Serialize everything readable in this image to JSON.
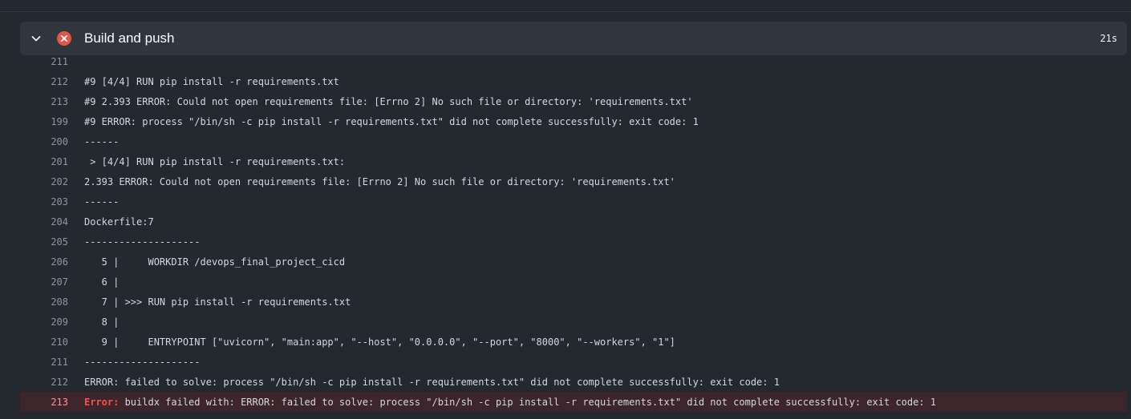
{
  "step": {
    "title": "Build and push",
    "duration": "21s",
    "status": "failed",
    "status_icon": "x-circle-icon",
    "chevron_icon": "chevron-down-icon",
    "colors": {
      "error": "#f85149",
      "header_bg": "#30363e",
      "log_bg": "#24292f",
      "error_row_bg": "#3d262b"
    }
  },
  "log": {
    "lines": [
      {
        "num": "211",
        "text": ""
      },
      {
        "num": "212",
        "text": "#9 [4/4] RUN pip install -r requirements.txt"
      },
      {
        "num": "213",
        "text": "#9 2.393 ERROR: Could not open requirements file: [Errno 2] No such file or directory: 'requirements.txt'"
      },
      {
        "num": "199",
        "text": "#9 ERROR: process \"/bin/sh -c pip install -r requirements.txt\" did not complete successfully: exit code: 1"
      },
      {
        "num": "200",
        "text": "------"
      },
      {
        "num": "201",
        "text": " > [4/4] RUN pip install -r requirements.txt:"
      },
      {
        "num": "202",
        "text": "2.393 ERROR: Could not open requirements file: [Errno 2] No such file or directory: 'requirements.txt'"
      },
      {
        "num": "203",
        "text": "------"
      },
      {
        "num": "204",
        "text": "Dockerfile:7"
      },
      {
        "num": "205",
        "text": "--------------------"
      },
      {
        "num": "206",
        "text": "   5 |     WORKDIR /devops_final_project_cicd"
      },
      {
        "num": "207",
        "text": "   6 |"
      },
      {
        "num": "208",
        "text": "   7 | >>> RUN pip install -r requirements.txt"
      },
      {
        "num": "209",
        "text": "   8 |"
      },
      {
        "num": "210",
        "text": "   9 |     ENTRYPOINT [\"uvicorn\", \"main:app\", \"--host\", \"0.0.0.0\", \"--port\", \"8000\", \"--workers\", \"1\"]"
      },
      {
        "num": "211",
        "text": "--------------------"
      },
      {
        "num": "212",
        "text": "ERROR: failed to solve: process \"/bin/sh -c pip install -r requirements.txt\" did not complete successfully: exit code: 1"
      }
    ],
    "error_line": {
      "num": "213",
      "label": "Error:",
      "text": " buildx failed with: ERROR: failed to solve: process \"/bin/sh -c pip install -r requirements.txt\" did not complete successfully: exit code: 1"
    }
  }
}
